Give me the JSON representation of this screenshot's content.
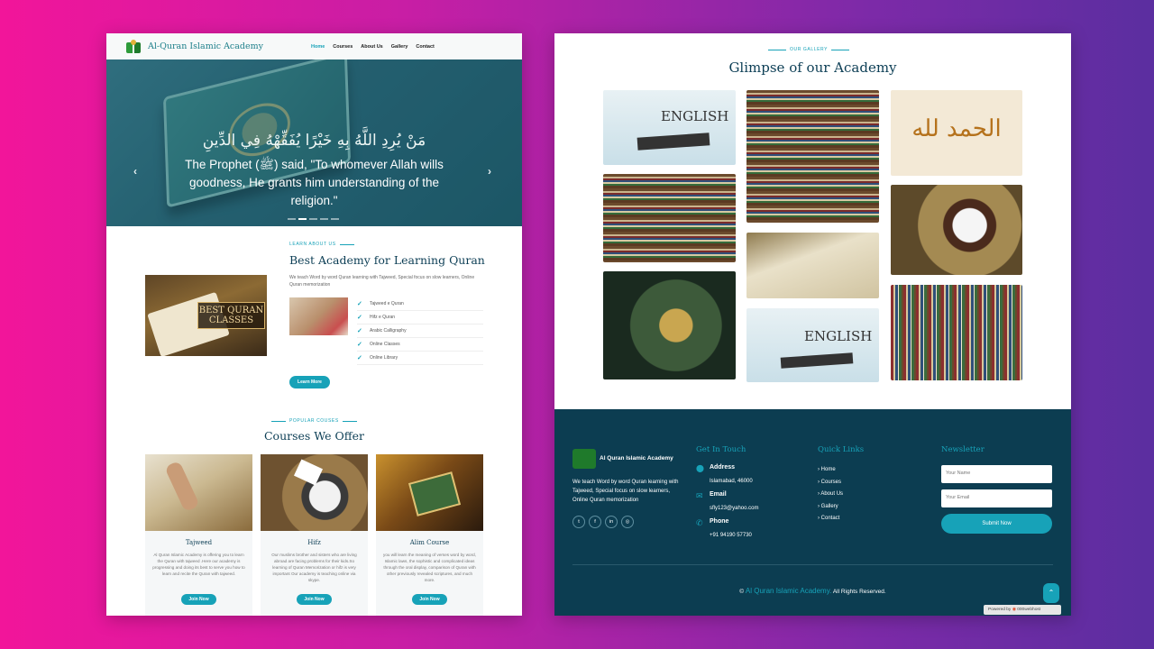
{
  "nav": {
    "brand": "Al-Quran Islamic Academy",
    "items": [
      "Home",
      "Courses",
      "About Us",
      "Gallery",
      "Contact"
    ],
    "active": "Home"
  },
  "hero": {
    "arabic": "مَنْ يُرِدِ اللَّهُ بِهِ خَيْرًا يُفَقِّهْهُ فِي الدِّينِ",
    "quote": "The Prophet (ﷺ) said, \"To whomever Allah wills goodness, He grants him understanding of the religion.\"",
    "prev": "‹",
    "next": "›"
  },
  "about": {
    "eyebrow": "LEARN ABOUT US",
    "title": "Best Academy for Learning Quran",
    "text": "We teach Word by word Quran learning with Tajweed, Special focus on slow learners, Online Quran memorization",
    "image_sign_line1": "BEST QURAN",
    "image_sign_line2": "CLASSES",
    "checklist": [
      "Tajweed e Quran",
      "Hifz e Quran",
      "Arabic Calligraphy",
      "Online Classes",
      "Online Library"
    ],
    "button": "Learn More"
  },
  "courses": {
    "eyebrow": "POPULAR COUSES",
    "title": "Courses We Offer",
    "items": [
      {
        "title": "Tajweed",
        "text": "Al Quran Islamic Academy is offering you to learn the Quran with tajweed .Here our academy is progressing and doing its best to serve you how to learn and recite the Quran with tajweed.",
        "button": "Join Now"
      },
      {
        "title": "Hifz",
        "text": "Our muslims brother and sisters who are living abroad are facing problems for their kids.So learning of Quran Memorization or hifz is very important Our academy is teaching online via skype.",
        "button": "Join Now"
      },
      {
        "title": "Alim Course",
        "text": "you will learn the meaning of verses word by word, Islamic laws, the sophistic and complicated ideas through the oral display, comparison of Quran with other previously revealed scriptures, and much more.",
        "button": "Join Now"
      }
    ]
  },
  "gallery": {
    "eyebrow": "OUR GALLERY",
    "title": "Glimpse of our Academy",
    "english_label": "ENGLISH",
    "calligraphy": "الحمد لله"
  },
  "footer": {
    "brand": "Al Quran Islamic Academy",
    "about": "We teach Word by word Quran learning with Tajweed, Special focus on slow learners, Online Quran memorization",
    "social": [
      "twitter-icon",
      "facebook-icon",
      "linkedin-icon",
      "instagram-icon"
    ],
    "contact_heading": "Get In Touch",
    "address_label": "Address",
    "address": "Islamabad, 46000",
    "email_label": "Email",
    "email": "sfly123@yahoo.com",
    "phone_label": "Phone",
    "phone": "+91 94190 57730",
    "links_heading": "Quick Links",
    "links": [
      "Home",
      "Courses",
      "About Us",
      "Gallery",
      "Contact"
    ],
    "newsletter_heading": "Newsletter",
    "name_placeholder": "Your Name",
    "email_placeholder": "Your Email",
    "submit": "Submit Now",
    "copyright_symbol": "©",
    "copyright_name": "Al Quran Islamic Academy.",
    "copyright_rest": "All Rights Reserved.",
    "powered_by": "Powered by",
    "host": "000webhost"
  },
  "colors": {
    "accent": "#17a2b8",
    "dark": "#0c3d51"
  }
}
